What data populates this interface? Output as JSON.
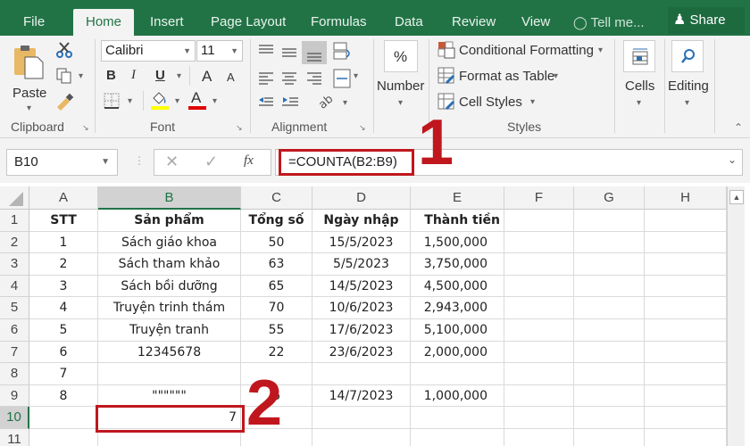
{
  "tabs": [
    {
      "label": "File",
      "active": false
    },
    {
      "label": "Home",
      "active": true
    },
    {
      "label": "Insert",
      "active": false
    },
    {
      "label": "Page Layout",
      "active": false
    },
    {
      "label": "Formulas",
      "active": false
    },
    {
      "label": "Data",
      "active": false
    },
    {
      "label": "Review",
      "active": false
    },
    {
      "label": "View",
      "active": false
    }
  ],
  "tell_me": "Tell me...",
  "share": "Share",
  "ribbon": {
    "clipboard": {
      "paste": "Paste",
      "label": "Clipboard"
    },
    "font": {
      "name": "Calibri",
      "size": "11",
      "bold": "B",
      "italic": "I",
      "underline": "U",
      "grow": "A",
      "shrink": "A",
      "font_color": "A",
      "label": "Font",
      "fill_color": "#ffff00",
      "text_color": "#e00000"
    },
    "alignment": {
      "label": "Alignment"
    },
    "number": {
      "symbol": "%",
      "label": "Number"
    },
    "styles": {
      "conditional": "Conditional Formatting",
      "format_table": "Format as Table",
      "cell_styles": "Cell Styles",
      "label": "Styles"
    },
    "cells": {
      "label": "Cells"
    },
    "editing": {
      "label": "Editing"
    }
  },
  "formula_bar": {
    "name_box": "B10",
    "formula": "=COUNTA(B2:B9)",
    "fx": "fx"
  },
  "annotations": {
    "one": "1",
    "two": "2"
  },
  "columns": [
    "A",
    "B",
    "C",
    "D",
    "E",
    "F",
    "G",
    "H"
  ],
  "selected_column": "B",
  "rows": [
    "1",
    "2",
    "3",
    "4",
    "5",
    "6",
    "7",
    "8",
    "9",
    "10",
    "11"
  ],
  "selected_row": "10",
  "table": {
    "headers": [
      "STT",
      "Sản phẩm",
      "Tổng số",
      "Ngày nhập",
      "Thành tiền"
    ],
    "data": [
      [
        "1",
        "Sách giáo khoa",
        "50",
        "15/5/2023",
        "1,500,000"
      ],
      [
        "2",
        "Sách tham khảo",
        "63",
        "5/5/2023",
        "3,750,000"
      ],
      [
        "3",
        "Sách bồi dưỡng",
        "65",
        "14/5/2023",
        "4,500,000"
      ],
      [
        "4",
        "Truyện trinh thám",
        "70",
        "10/6/2023",
        "2,943,000"
      ],
      [
        "5",
        "Truyện tranh",
        "55",
        "17/6/2023",
        "5,100,000"
      ],
      [
        "6",
        "12345678",
        "22",
        "23/6/2023",
        "2,000,000"
      ],
      [
        "7",
        "",
        "",
        "",
        ""
      ],
      [
        "8",
        "\"\"\"\"\"\"",
        "6",
        "14/7/2023",
        "1,000,000"
      ],
      [
        "",
        "7",
        "",
        "",
        ""
      ]
    ]
  },
  "colors": {
    "excel_green": "#217346",
    "annotation_red": "#c0171e"
  }
}
